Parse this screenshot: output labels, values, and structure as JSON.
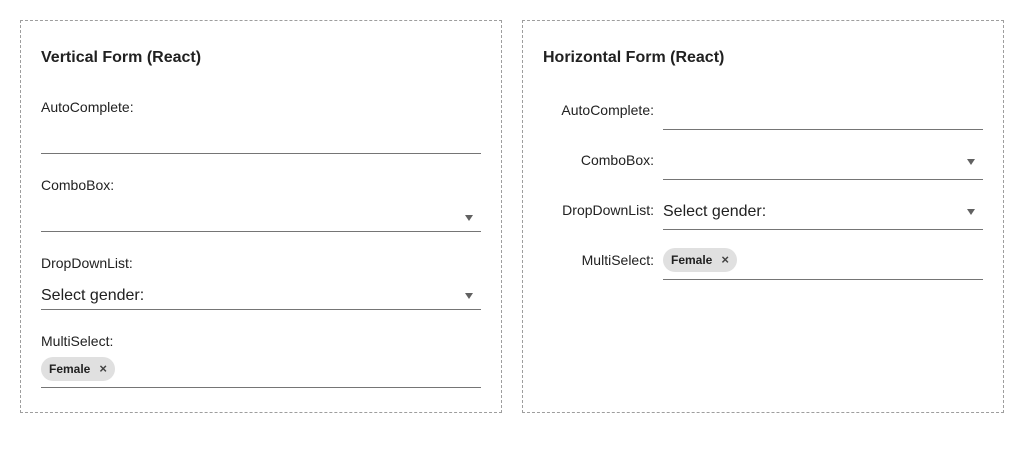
{
  "vertical_form": {
    "title": "Vertical Form (React)",
    "autocomplete": {
      "label": "AutoComplete:",
      "value": ""
    },
    "combobox": {
      "label": "ComboBox:",
      "value": ""
    },
    "dropdownlist": {
      "label": "DropDownList:",
      "value": "Select gender:"
    },
    "multiselect": {
      "label": "MultiSelect:",
      "chips": [
        "Female"
      ],
      "chip_remove": "×"
    }
  },
  "horizontal_form": {
    "title": "Horizontal Form (React)",
    "autocomplete": {
      "label": "AutoComplete:",
      "value": ""
    },
    "combobox": {
      "label": "ComboBox:",
      "value": ""
    },
    "dropdownlist": {
      "label": "DropDownList:",
      "value": "Select gender:"
    },
    "multiselect": {
      "label": "MultiSelect:",
      "chips": [
        "Female"
      ],
      "chip_remove": "×"
    }
  },
  "icons": {
    "dropdown": "chevron-down-icon",
    "chip_remove": "close-icon"
  }
}
